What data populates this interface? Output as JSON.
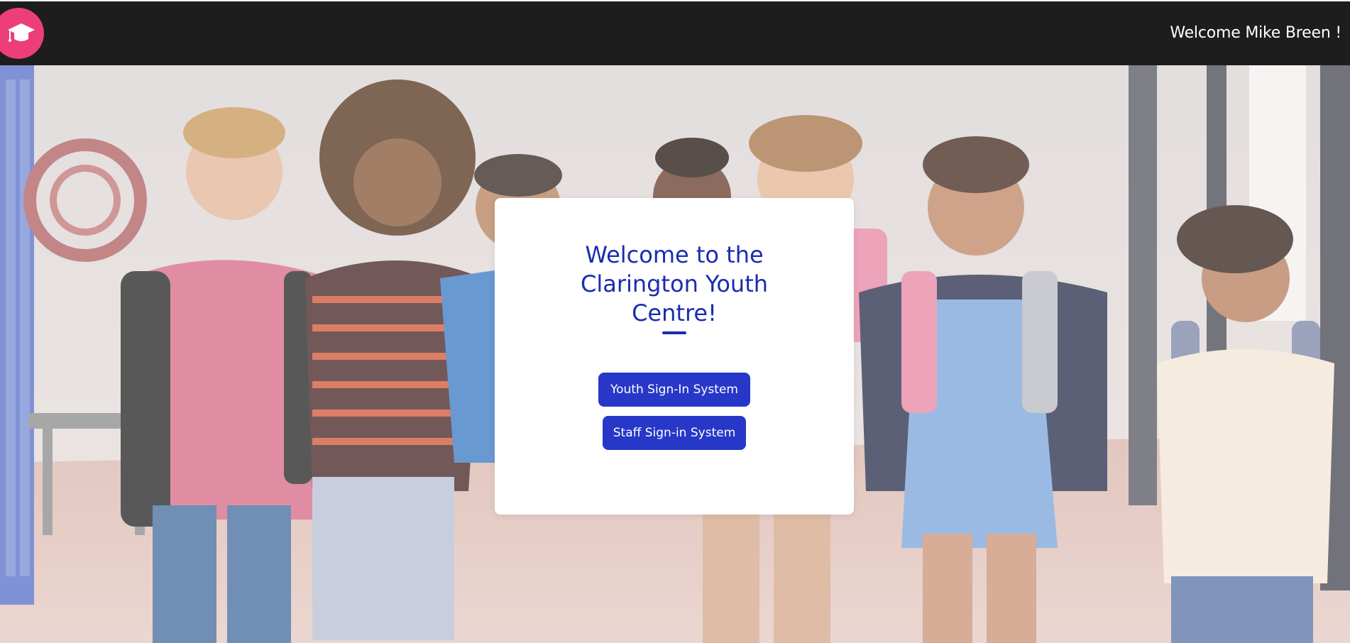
{
  "header": {
    "logo_icon": "graduation-cap-icon",
    "welcome_text": "Welcome Mike Breen !"
  },
  "card": {
    "title_lines": [
      "Welcome to the",
      "Clarington Youth",
      "Centre!"
    ],
    "youth_button_label": "Youth Sign-In System",
    "staff_button_label": "Staff Sign-in System"
  },
  "colors": {
    "topbar": "#1d1d1d",
    "logo": "#ec3f78",
    "title": "#1a2cb0",
    "button": "#2738c8"
  }
}
